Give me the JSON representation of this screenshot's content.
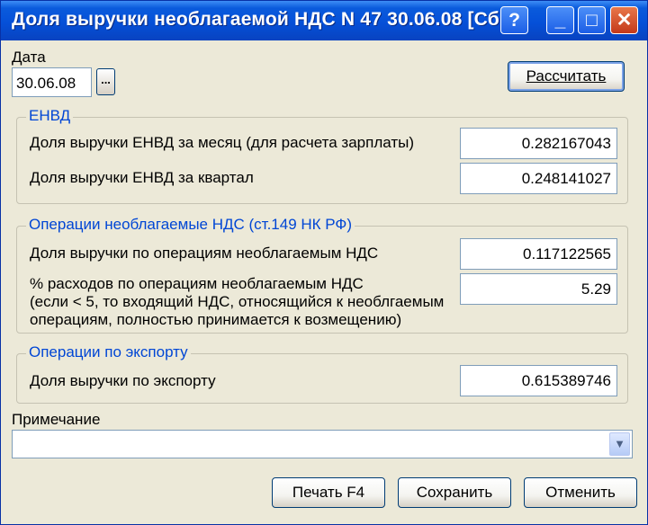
{
  "window": {
    "title": "Доля выручки необлагаемой НДС N 47 30.06.08 [Сб",
    "help_label": "?",
    "min_label": "_",
    "max_label": "□",
    "close_label": "✕"
  },
  "date": {
    "label": "Дата",
    "value": "30.06.08",
    "picker_label": "..."
  },
  "calculate_label": "Рассчитать",
  "envd": {
    "title": "ЕНВД",
    "month_label": "Доля выручки ЕНВД за месяц (для расчета зарплаты)",
    "month_value": "0.282167043",
    "quarter_label": "Доля выручки ЕНВД за квартал",
    "quarter_value": "0.248141027"
  },
  "nds": {
    "title": "Операции необлагаемые НДС (ст.149 НК РФ)",
    "share_label": "Доля выручки по операциям необлагаемым НДС",
    "share_value": "0.117122565",
    "expense_label_1": "% расходов по операциям необлагаемым НДС",
    "expense_label_2": "(если < 5, то входящий НДС, относящийся к необлгаемым",
    "expense_label_3": "операциям, полностью принимается к возмещению)",
    "expense_value": "5.29"
  },
  "export": {
    "title": "Операции по экспорту",
    "share_label": "Доля выручки по экспорту",
    "share_value": "0.615389746"
  },
  "note": {
    "label": "Примечание",
    "value": "",
    "dropdown_icon": "chevron-down-icon"
  },
  "buttons": {
    "print": "Печать F4",
    "save": "Сохранить",
    "cancel": "Отменить"
  },
  "colors": {
    "title_bar": "#0550d8",
    "group_title": "#0046d5",
    "dialog_bg": "#ece9d8"
  }
}
